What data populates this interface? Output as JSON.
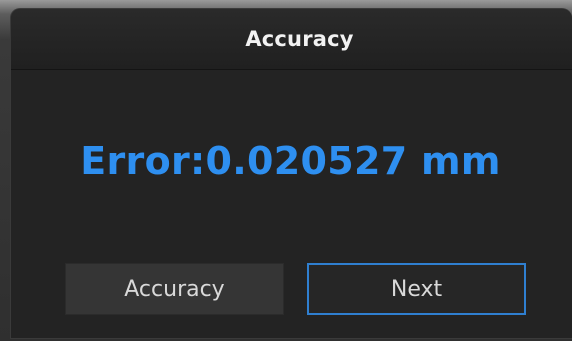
{
  "dialog": {
    "title": "Accuracy",
    "error_text": "Error:0.020527 mm",
    "buttons": {
      "accuracy_label": "Accuracy",
      "next_label": "Next"
    }
  },
  "colors": {
    "accent": "#2e8ff0",
    "next_border": "#2f7fd0",
    "dialog_bg": "#232323"
  }
}
